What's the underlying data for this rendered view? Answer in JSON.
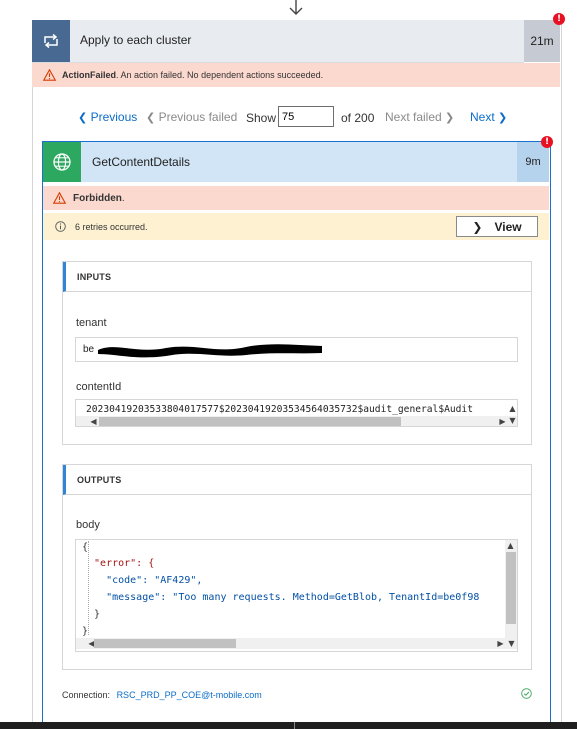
{
  "outer": {
    "title": "Apply to each cluster",
    "duration": "21m",
    "error_badge": "!",
    "banner_strong": "ActionFailed",
    "banner_text": ". An action failed. No dependent actions succeeded."
  },
  "pager": {
    "previous": "Previous",
    "previous_failed": "Previous failed",
    "show_label": "Show",
    "show_value": "75",
    "of_total": "of 200",
    "next_failed": "Next failed",
    "next": "Next"
  },
  "action": {
    "title": "GetContentDetails",
    "duration": "9m",
    "error_badge": "!",
    "status_text": "Forbidden",
    "status_period": ".",
    "retries_text": "6 retries occurred.",
    "view_label": "View"
  },
  "inputs": {
    "header": "INPUTS",
    "tenant_label": "tenant",
    "tenant_value": "be",
    "content_id_label": "contentId",
    "content_id_value": "20230419203533804017577$2023041920353456403573​2$audit_general$Audit"
  },
  "outputs": {
    "header": "OUTPUTS",
    "body_label": "body",
    "code_lines": [
      "{",
      "  \"error\": {",
      "    \"code\": \"AF429\",",
      "    \"message\": \"Too many requests. Method=GetBlob, TenantId=be0f98",
      "  }",
      "}"
    ]
  },
  "footer": {
    "connection_label": "Connection:",
    "connection_value": "RSC_PRD_PP_COE@t-mobile.com"
  },
  "icons": {
    "loop": "loop-icon",
    "globe": "globe-icon",
    "warning": "warning-icon",
    "info": "info-icon",
    "check": "check-circle-icon"
  },
  "colors": {
    "loop_accent": "#486991",
    "action_accent": "#2da860",
    "selection_border": "#1b6fd1",
    "error_banner": "#fbd9cf",
    "info_banner": "#fdf1d2",
    "link": "#0b6cc8",
    "error_badge": "#e81123"
  }
}
